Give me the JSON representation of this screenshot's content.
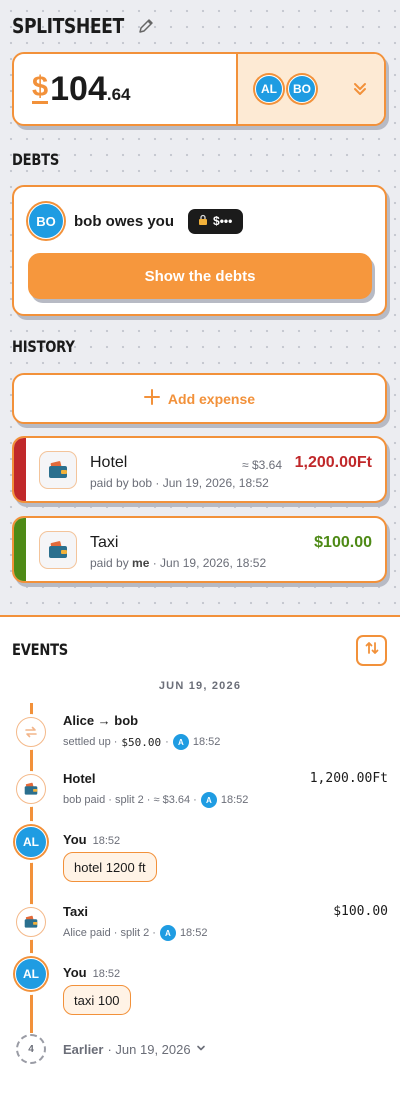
{
  "app": {
    "title": "SPLITSHEET"
  },
  "balance": {
    "currency": "$",
    "whole": "104",
    "cents": ".64",
    "avatars": [
      "AL",
      "BO"
    ]
  },
  "debts": {
    "heading": "DEBTS",
    "avatar": "BO",
    "text": "bob owes you",
    "hidden_amount": "$•••",
    "button": "Show the debts"
  },
  "history": {
    "heading": "HISTORY",
    "add_label": "Add expense",
    "items": [
      {
        "name": "Hotel",
        "payer": "bob",
        "date": "Jun 19, 2026, 18:52",
        "approx": "≈ $3.64",
        "amount": "1,200.00Ft",
        "accent": "#c0282a"
      },
      {
        "name": "Taxi",
        "payer": "me",
        "date": "Jun 19, 2026, 18:52",
        "approx": "",
        "amount": "$100.00",
        "accent": "#4e8a16"
      }
    ]
  },
  "events": {
    "heading": "EVENTS",
    "date": "JUN 19, 2026",
    "items": [
      {
        "kind": "settle",
        "title": "Alice → bob",
        "sub": "settled up ·",
        "amount": "$50.00",
        "by": "A",
        "time": "18:52"
      },
      {
        "kind": "expense",
        "title": "Hotel",
        "sub": "bob paid · split 2 · ≈ $3.64 ·",
        "amount": "1,200.00Ft",
        "by": "A",
        "time": "18:52"
      },
      {
        "kind": "message",
        "author": "You",
        "avatar": "AL",
        "time": "18:52",
        "text": "hotel 1200 ft"
      },
      {
        "kind": "expense",
        "title": "Taxi",
        "sub": "Alice paid · split 2 ·",
        "amount": "$100.00",
        "by": "A",
        "time": "18:52"
      },
      {
        "kind": "message",
        "author": "You",
        "avatar": "AL",
        "time": "18:52",
        "text": "taxi 100"
      }
    ],
    "earlier": {
      "count": "4",
      "label": "Earlier",
      "date": "· Jun 19, 2026"
    }
  },
  "colors": {
    "accent": "#f2913a",
    "avatar": "#1f9ce2",
    "negative": "#c0282a",
    "positive": "#4e8a16"
  }
}
